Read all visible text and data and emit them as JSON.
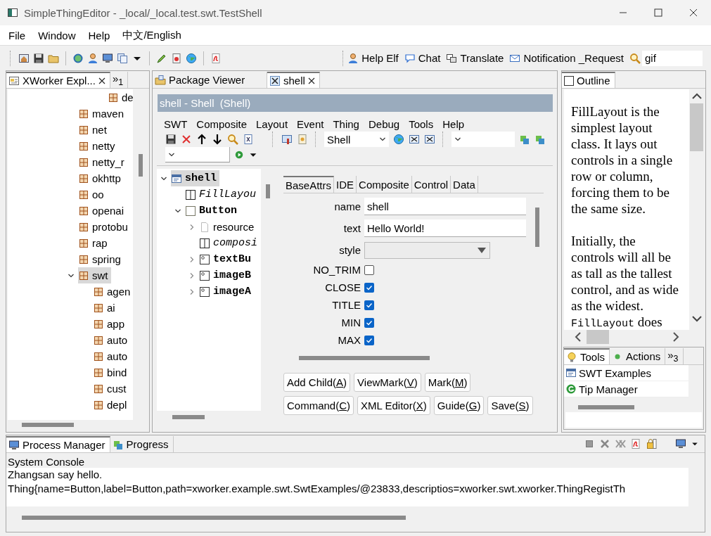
{
  "window": {
    "title": "SimpleThingEditor - _local/_local.test.swt.TestShell"
  },
  "menu": [
    "File",
    "Window",
    "Help",
    "中文/English"
  ],
  "toolbar": {
    "links": [
      {
        "label": "Help Elf"
      },
      {
        "label": "Chat"
      },
      {
        "label": "Translate"
      },
      {
        "label": "Notification _Request"
      }
    ],
    "search": {
      "value": "gif"
    }
  },
  "explorer": {
    "tabs": [
      {
        "label": "XWorker Expl...",
        "selected": true,
        "closable": true
      },
      {
        "label": "»$_{1}$",
        "selected": false,
        "closable": false
      }
    ],
    "tree": {
      "partial_child": "de",
      "items": [
        {
          "label": "maven",
          "selected": false
        },
        {
          "label": "net",
          "selected": false
        },
        {
          "label": "netty",
          "selected": false
        },
        {
          "label": "netty_r",
          "selected": false
        },
        {
          "label": "okhttp",
          "selected": false
        },
        {
          "label": "oo",
          "selected": false
        },
        {
          "label": "openai",
          "selected": false
        },
        {
          "label": "protobu",
          "selected": false
        },
        {
          "label": "rap",
          "selected": false
        },
        {
          "label": "spring",
          "selected": false
        },
        {
          "label": "swt",
          "selected": true,
          "expanded": true,
          "children": [
            {
              "label": "agen",
              "selected": false
            },
            {
              "label": "ai",
              "selected": false
            },
            {
              "label": "app",
              "selected": false
            },
            {
              "label": "auto",
              "selected": false
            },
            {
              "label": "auto",
              "selected": false
            },
            {
              "label": "bind",
              "selected": false
            },
            {
              "label": "cust",
              "selected": false
            },
            {
              "label": "depl",
              "selected": false
            }
          ]
        }
      ]
    }
  },
  "editor": {
    "tabs": [
      {
        "label": "Package Viewer",
        "selected": false,
        "closable": false
      },
      {
        "label": "shell",
        "selected": true,
        "closable": true
      }
    ],
    "title": "shell - Shell  (Shell)",
    "menu": [
      "SWT",
      "Composite",
      "Layout",
      "Event",
      "Thing",
      "Debug",
      "Tools",
      "Help"
    ],
    "type_combo": {
      "value": "Shell"
    },
    "tree": [
      {
        "label": "shell",
        "kind": "shell",
        "selected": true,
        "expanded": true,
        "children": [
          {
            "label": "FillLayou",
            "kind": "layout",
            "selected": false
          },
          {
            "label": "Button",
            "kind": "group",
            "selected": false,
            "expanded": true,
            "children": [
              {
                "label": "resource",
                "kind": "resource",
                "selected": false,
                "expanded": false
              },
              {
                "label": "composi",
                "kind": "layout",
                "selected": false
              },
              {
                "label": "textBu",
                "kind": "button",
                "selected": false,
                "expanded": false
              },
              {
                "label": "imageB",
                "kind": "button",
                "selected": false,
                "expanded": false
              },
              {
                "label": "imageA",
                "kind": "button",
                "selected": false,
                "expanded": false
              }
            ]
          }
        ]
      }
    ],
    "attr_tabs": [
      {
        "label": "BaseAttrs",
        "selected": true
      },
      {
        "label": "IDE",
        "selected": false
      },
      {
        "label": "Composite",
        "selected": false
      },
      {
        "label": "Control",
        "selected": false
      },
      {
        "label": "Data",
        "selected": false
      }
    ],
    "fields": [
      {
        "kind": "text",
        "label": "name",
        "value": "shell"
      },
      {
        "kind": "text",
        "label": "text",
        "value": "Hello World!"
      },
      {
        "kind": "select",
        "label": "style"
      },
      {
        "kind": "checkbox",
        "label": "NO_TRIM",
        "checked": false
      },
      {
        "kind": "checkbox",
        "label": "CLOSE",
        "checked": true
      },
      {
        "kind": "checkbox",
        "label": "TITLE",
        "checked": true
      },
      {
        "kind": "checkbox",
        "label": "MIN",
        "checked": true
      },
      {
        "kind": "checkbox",
        "label": "MAX",
        "checked": true
      }
    ],
    "button_rows": [
      {
        "buttons": [
          {
            "before": "Add Child(",
            "mnemonic": "A",
            "after": ")"
          },
          {
            "before": "ViewMark(",
            "mnemonic": "V",
            "after": ")"
          },
          {
            "before": "Mark(",
            "mnemonic": "M",
            "after": ")"
          }
        ]
      },
      {
        "buttons": [
          {
            "before": "Command(",
            "mnemonic": "C",
            "after": ")"
          },
          {
            "before": "XML Editor(",
            "mnemonic": "X",
            "after": ")"
          },
          {
            "before": "Guide(",
            "mnemonic": "G",
            "after": ")"
          },
          {
            "before": "Save(",
            "mnemonic": "S",
            "after": ")"
          }
        ]
      }
    ]
  },
  "outline": {
    "tab": {
      "label": "Outline"
    },
    "paragraphs": [
      {
        "segments": [
          {
            "kind": "text",
            "text": "FillLayout is the simplest layout class. It lays out controls in a single row or column, forcing them to be the same size."
          }
        ]
      },
      {
        "segments": [
          {
            "kind": "text",
            "text": "Initially, the controls will all be as tall as the tallest control, and as wide as the widest."
          },
          {
            "kind": "code",
            "text": "FillLayout"
          },
          {
            "kind": "text",
            "text": "does"
          }
        ]
      }
    ]
  },
  "tools": {
    "tabs": [
      {
        "label": "Tools",
        "kind": "bulb",
        "selected": true
      },
      {
        "label": "Actions",
        "kind": "dot",
        "selected": false
      },
      {
        "label": "»$_{3}$",
        "kind": "more",
        "selected": false
      }
    ],
    "items": [
      {
        "label": "SWT Examples",
        "kind": "window"
      },
      {
        "label": "Tip Manager",
        "kind": "tip"
      }
    ]
  },
  "console": {
    "tabs": [
      {
        "label": "Process Manager",
        "selected": true
      },
      {
        "label": "Progress",
        "selected": false
      }
    ],
    "title": "System Console",
    "lines": [
      "Zhangsan say hello.",
      "Thing{name=Button,label=Button,path=xworker.example.swt.SwtExamples/@23833,descriptios=xworker.swt.xworker.ThingRegistTh"
    ]
  }
}
